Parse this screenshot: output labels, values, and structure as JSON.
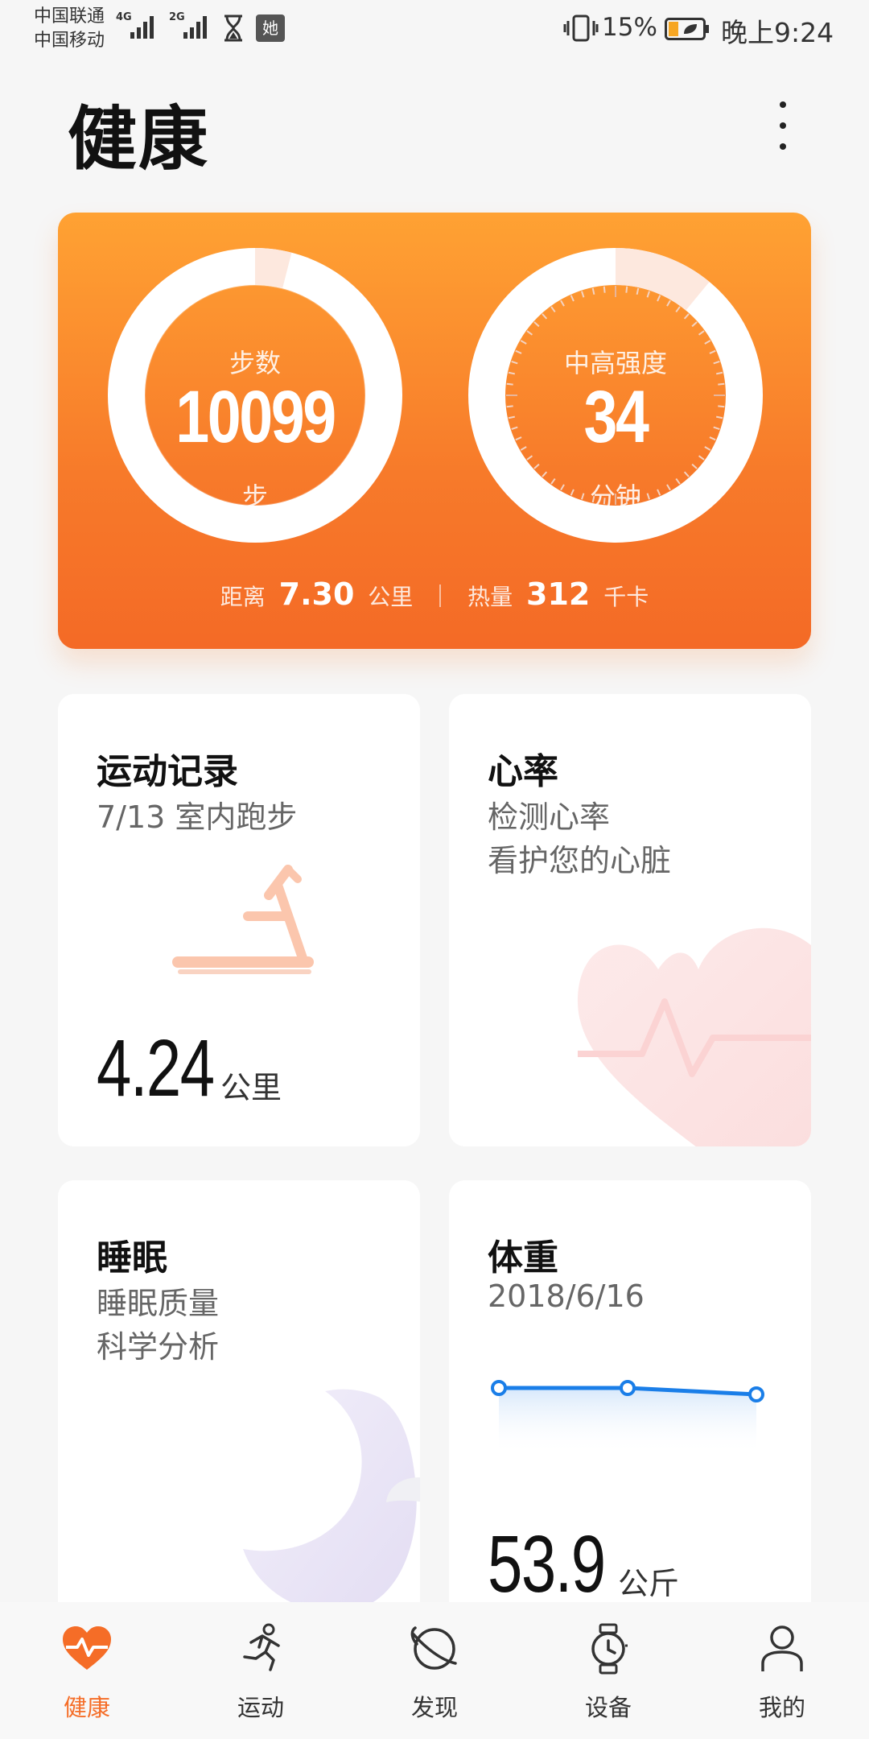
{
  "status_bar": {
    "carrier_1": "中国联通",
    "carrier_2": "中国移动",
    "sim_1_network": "4G",
    "sim_2_network": "2G",
    "app_badge": "她",
    "battery_percent": "15%",
    "time": "晚上9:24",
    "icons": [
      "signal-icon",
      "hourglass-icon",
      "app-badge-icon",
      "vibrate-icon",
      "battery-icon"
    ]
  },
  "header": {
    "title": "健康",
    "menu_icon": "more-vertical-icon"
  },
  "activity": {
    "steps": {
      "label": "步数",
      "value": "10099",
      "unit": "步",
      "progress": 0.04
    },
    "intensity": {
      "label": "中高强度",
      "value": "34",
      "unit": "分钟",
      "progress": 0.11
    },
    "distance": {
      "label": "距离",
      "value": "7.30",
      "unit": "公里"
    },
    "calories": {
      "label": "热量",
      "value": "312",
      "unit": "千卡"
    }
  },
  "tiles": {
    "workout": {
      "title": "运动记录",
      "subtitle": "7/13 室内跑步",
      "value": "4.24",
      "unit": "公里",
      "icon": "treadmill-icon"
    },
    "heart": {
      "title": "心率",
      "line1": "检测心率",
      "line2": "看护您的心脏",
      "icon": "heart-pulse-icon"
    },
    "sleep": {
      "title": "睡眠",
      "line1": "睡眠质量",
      "line2": "科学分析",
      "icon": "moon-icon"
    },
    "weight": {
      "title": "体重",
      "date": "2018/6/16",
      "value": "53.9",
      "unit": "公斤",
      "icon": "weight-trend-icon",
      "trend": [
        0.0,
        0.0,
        -0.1
      ]
    }
  },
  "bottom_nav": [
    {
      "label": "健康",
      "icon": "heart-icon",
      "active": true
    },
    {
      "label": "运动",
      "icon": "running-icon",
      "active": false
    },
    {
      "label": "发现",
      "icon": "planet-icon",
      "active": false
    },
    {
      "label": "设备",
      "icon": "watch-icon",
      "active": false
    },
    {
      "label": "我的",
      "icon": "person-icon",
      "active": false
    }
  ],
  "colors": {
    "accent": "#f56d27",
    "card_gradient_top": "#ffa233",
    "card_gradient_bottom": "#f46a26",
    "weight_line": "#1a7ee8"
  }
}
